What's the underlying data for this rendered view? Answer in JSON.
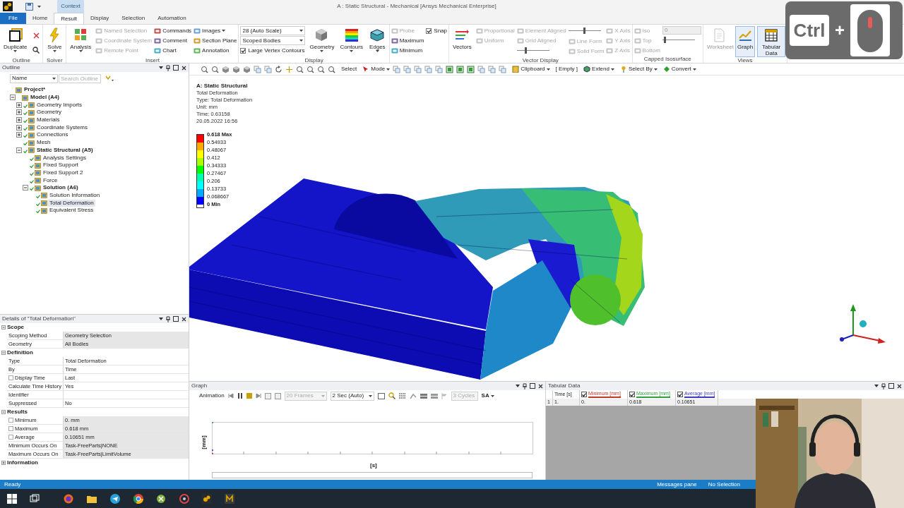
{
  "title_bar": {
    "title": "A : Static Structural - Mechanical [Ansys Mechanical Enterprise]",
    "context_label": "Context"
  },
  "tabs": [
    {
      "label": "File",
      "kind": "file",
      "selected": false
    },
    {
      "label": "Home",
      "kind": "tab",
      "selected": false
    },
    {
      "label": "Result",
      "kind": "tab",
      "selected": true
    },
    {
      "label": "Display",
      "kind": "tab",
      "selected": false
    },
    {
      "label": "Selection",
      "kind": "tab",
      "selected": false
    },
    {
      "label": "Automation",
      "kind": "tab",
      "selected": false
    }
  ],
  "ribbon": {
    "groups": [
      {
        "label": "Outline",
        "columns": [
          [
            {
              "kind": "big",
              "label": "Duplicate",
              "caret": true
            }
          ],
          [
            {
              "kind": "close_button"
            },
            {
              "kind": "search_button"
            }
          ]
        ]
      },
      {
        "label": "Solver",
        "columns": [
          [
            {
              "kind": "big",
              "label": "Solve",
              "caret": true
            }
          ]
        ]
      },
      {
        "label": "Insert",
        "columns": [
          [
            {
              "kind": "big",
              "label": "Analysis",
              "caret": true
            }
          ],
          [
            {
              "kind": "small",
              "label": "Named Selection",
              "disabled": true
            },
            {
              "kind": "small",
              "label": "Coordinate System",
              "disabled": true
            },
            {
              "kind": "small",
              "label": "Remote Point",
              "disabled": true
            }
          ],
          [
            {
              "kind": "small",
              "label": "Commands",
              "disabled": false
            },
            {
              "kind": "small",
              "label": "Comment",
              "disabled": false
            },
            {
              "kind": "small",
              "label": "Chart",
              "disabled": false
            }
          ],
          [
            {
              "kind": "small",
              "label": "Images",
              "disabled": false,
              "caret": true
            },
            {
              "kind": "small",
              "label": "Section Plane",
              "disabled": false
            },
            {
              "kind": "small",
              "label": "Annotation",
              "disabled": false
            }
          ]
        ]
      },
      {
        "label": "Display",
        "columns": [
          [
            {
              "kind": "combo",
              "value": "28 (Auto Scale)"
            },
            {
              "kind": "combo",
              "value": "Scoped Bodies"
            },
            {
              "kind": "check",
              "label": "Large Vertex Contours",
              "checked": true
            }
          ],
          [
            {
              "kind": "big",
              "label": "Geometry",
              "caret": true
            }
          ],
          [
            {
              "kind": "big",
              "label": "Contours",
              "caret": true
            }
          ],
          [
            {
              "kind": "big",
              "label": "Edges",
              "caret": true
            }
          ]
        ]
      },
      {
        "columns": [
          [
            {
              "kind": "small",
              "label": "Probe",
              "disabled": true
            },
            {
              "kind": "small",
              "label": "Maximum",
              "disabled": false
            },
            {
              "kind": "small",
              "label": "Minimum",
              "disabled": false
            }
          ],
          [
            {
              "kind": "check",
              "label": "Snap",
              "checked": true
            }
          ]
        ]
      },
      {
        "label": "Vector Display",
        "columns": [
          [
            {
              "kind": "big",
              "label": "Vectors"
            }
          ],
          [
            {
              "kind": "small",
              "label": "Proportional",
              "disabled": true
            },
            {
              "kind": "small",
              "label": "Uniform",
              "disabled": true
            }
          ],
          [
            {
              "kind": "small",
              "label": "Element Aligned",
              "disabled": true
            },
            {
              "kind": "small",
              "label": "Grid Aligned",
              "disabled": true
            },
            {
              "kind": "slider",
              "level": 0.25
            }
          ],
          [
            {
              "kind": "slider",
              "level": 0.5
            },
            {
              "kind": "small",
              "label": "Line Form",
              "disabled": true
            },
            {
              "kind": "small",
              "label": "Solid Form",
              "disabled": true
            }
          ],
          [
            {
              "kind": "small",
              "label": "X Axis",
              "disabled": true
            },
            {
              "kind": "small",
              "label": "Y Axis",
              "disabled": true
            },
            {
              "kind": "small",
              "label": "Z Axis",
              "disabled": true
            }
          ]
        ]
      },
      {
        "label": "Capped Isosurface",
        "columns": [
          [
            {
              "kind": "small",
              "label": "Iso",
              "disabled": true
            },
            {
              "kind": "small",
              "label": "Top",
              "disabled": true
            },
            {
              "kind": "small",
              "label": "Bottom",
              "disabled": true
            }
          ],
          [
            {
              "kind": "field",
              "value": "0"
            },
            {
              "kind": "slider",
              "level": 0.05
            }
          ]
        ]
      },
      {
        "label": "Views",
        "columns": [
          [
            {
              "kind": "big",
              "label": "Worksheet",
              "disabled": true,
              "on": false
            }
          ],
          [
            {
              "kind": "big",
              "label": "Graph",
              "on": true
            }
          ],
          [
            {
              "kind": "big",
              "label": "Tabular Data",
              "on": true
            }
          ]
        ]
      }
    ]
  },
  "graphics_toolbar": {
    "select_label": "Select",
    "mode_label": "Mode",
    "clipboard_label": "Clipboard",
    "clipboard_value": "[ Empty ]",
    "extend_label": "Extend",
    "select_by_label": "Select By",
    "convert_label": "Convert"
  },
  "outline": {
    "title": "Outline",
    "sort_field": "Name",
    "search": {
      "placeholder": "Search Outline"
    },
    "tree": [
      {
        "label": "Project*",
        "selected": false,
        "solved": false,
        "children": [
          {
            "label": "Model (A4)",
            "expanded": true,
            "selected": false,
            "solved": false,
            "children": [
              {
                "label": "Geometry Imports",
                "expanded": false,
                "selected": false,
                "solved": true
              },
              {
                "label": "Geometry",
                "expanded": false,
                "selected": false,
                "solved": true
              },
              {
                "label": "Materials",
                "expanded": false,
                "selected": false,
                "solved": true
              },
              {
                "label": "Coordinate Systems",
                "expanded": false,
                "selected": false,
                "solved": true
              },
              {
                "label": "Connections",
                "expanded": false,
                "selected": false,
                "solved": true
              },
              {
                "label": "Mesh",
                "selected": false,
                "solved": true
              },
              {
                "label": "Static Structural (A5)",
                "expanded": true,
                "selected": false,
                "solved": true,
                "children": [
                  {
                    "label": "Analysis Settings",
                    "selected": false,
                    "solved": true
                  },
                  {
                    "label": "Fixed Support",
                    "selected": false,
                    "solved": true
                  },
                  {
                    "label": "Fixed Support 2",
                    "selected": false,
                    "solved": true
                  },
                  {
                    "label": "Force",
                    "selected": false,
                    "solved": true
                  },
                  {
                    "label": "Solution (A6)",
                    "expanded": true,
                    "selected": false,
                    "solved": true,
                    "children": [
                      {
                        "label": "Solution Information",
                        "selected": false,
                        "solved": true
                      },
                      {
                        "label": "Total Deformation",
                        "selected": true,
                        "solved": true
                      },
                      {
                        "label": "Equivalent Stress",
                        "selected": false,
                        "solved": true
                      }
                    ]
                  }
                ]
              }
            ]
          }
        ]
      }
    ]
  },
  "details": {
    "title": "Details of \"Total Deformation\"",
    "sections": [
      {
        "title": "Scope",
        "expanded": true,
        "rows": [
          {
            "label": "Scoping Method",
            "value": "Geometry Selection",
            "readonly": true,
            "kind": "plain"
          },
          {
            "label": "Geometry",
            "value": "All Bodies",
            "readonly": true,
            "kind": "plain"
          }
        ]
      },
      {
        "title": "Definition",
        "expanded": true,
        "rows": [
          {
            "label": "Type",
            "value": "Total Deformation",
            "readonly": false,
            "kind": "plain"
          },
          {
            "label": "By",
            "value": "Time",
            "readonly": false,
            "kind": "plain"
          },
          {
            "label": "Display Time",
            "value": "Last",
            "readonly": false,
            "kind": "checkbox",
            "checked": false
          },
          {
            "label": "Calculate Time History",
            "value": "Yes",
            "readonly": false,
            "kind": "plain"
          },
          {
            "label": "Identifier",
            "readonly": false,
            "kind": "plain"
          },
          {
            "label": "Suppressed",
            "value": "No",
            "readonly": false,
            "kind": "plain"
          }
        ]
      },
      {
        "title": "Results",
        "expanded": true,
        "rows": [
          {
            "label": "Minimum",
            "value": "0. mm",
            "readonly": true,
            "kind": "checkbox",
            "checked": false
          },
          {
            "label": "Maximum",
            "value": "0.618 mm",
            "readonly": true,
            "kind": "checkbox",
            "checked": false
          },
          {
            "label": "Average",
            "value": "0.10651 mm",
            "readonly": true,
            "kind": "checkbox",
            "checked": false
          },
          {
            "label": "Minimum Occurs On",
            "value": "Task-FreeParts|NONE",
            "readonly": true,
            "kind": "plain"
          },
          {
            "label": "Maximum Occurs On",
            "value": "Task-FreeParts|LimitVolume",
            "readonly": true,
            "kind": "plain"
          }
        ]
      },
      {
        "title": "Information",
        "expanded": false
      }
    ]
  },
  "viewport": {
    "title": "A: Static Structural",
    "info_lines": [
      "Total Deformation",
      "Type: Total Deformation",
      "Unit: mm",
      "Time: 0.63158",
      "20.05.2022 16:56"
    ],
    "legend": {
      "labels": [
        "0.618 Max",
        "0.54933",
        "0.48067",
        "0.412",
        "0.34333",
        "0.27467",
        "0.206",
        "0.13733",
        "0.068667",
        "0 Min"
      ],
      "bands": [
        {
          "color": "#ff0000"
        },
        {
          "color": "#ffaa00"
        },
        {
          "color": "#ffff00"
        },
        {
          "color": "#aaff00"
        },
        {
          "color": "#00ff00"
        },
        {
          "color": "#00ffaa"
        },
        {
          "color": "#00ffff"
        },
        {
          "color": "#00aaff"
        },
        {
          "color": "#0000ff"
        }
      ]
    }
  },
  "graph": {
    "title": "Graph",
    "animation_label": "Animation",
    "frames": {
      "value": "20 Frames",
      "disabled": true
    },
    "duration": {
      "value": "2 Sec (Auto)",
      "disabled": false
    },
    "cycles": {
      "value": "3 Cycles",
      "disabled": true
    },
    "sa_label": "SA",
    "y_label": "[mm]",
    "x_label": "[s]"
  },
  "tabular_data": {
    "title": "Tabular Data",
    "columns": [
      {
        "label": "Time [s]",
        "kind": "plain"
      },
      {
        "label": "Minimum [mm]",
        "kind": "series",
        "checked": true,
        "color": "#c0392b"
      },
      {
        "label": "Maximum [mm]",
        "kind": "series",
        "checked": true,
        "color": "#2e9e3e"
      },
      {
        "label": "Average [mm]",
        "kind": "series",
        "checked": true,
        "color": "#3b3bc4"
      }
    ],
    "rows": [
      {
        "index": "1",
        "cells": [
          "1.",
          "0.",
          "0.618",
          "0.10651"
        ]
      }
    ]
  },
  "status_bar": {
    "status": "Ready",
    "messages": "Messages pane",
    "selection": "No Selection"
  },
  "key_overlay": {
    "key": "Ctrl",
    "joiner": "+"
  }
}
